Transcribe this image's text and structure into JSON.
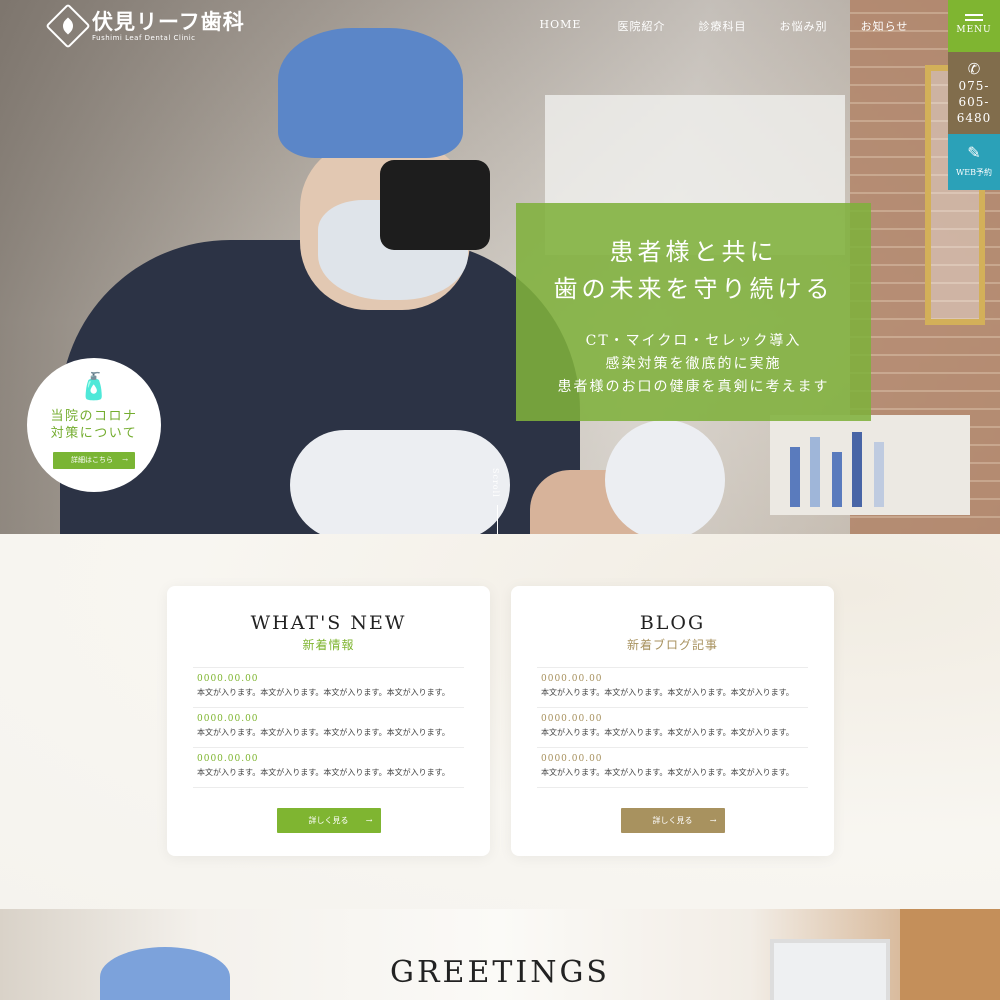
{
  "header": {
    "logo_name": "伏見リーフ歯科",
    "logo_sub": "Fushimi Leaf Dental Clinic",
    "nav": [
      "HOME",
      "医院紹介",
      "診療科目",
      "お悩み別",
      "お知らせ"
    ]
  },
  "side": {
    "menu_label": "MENU",
    "tel_lines": [
      "075-",
      "605-",
      "6480"
    ],
    "web_label": "WEB予約"
  },
  "hero": {
    "catch_line1": "患者様と共に",
    "catch_line2": "歯の未来を守り続ける",
    "points": [
      "CT・マイクロ・セレック導入",
      "感染対策を徹底的に実施",
      "患者様のお口の健康を真剣に考えます"
    ],
    "scroll_label": "Scroll"
  },
  "corona": {
    "line1": "当院のコロナ",
    "line2": "対策について",
    "button": "詳細はこちら"
  },
  "news": {
    "title": "WHAT'S NEW",
    "subtitle": "新着情報",
    "items": [
      {
        "date": "0000.00.00",
        "text": "本文が入ります。本文が入ります。本文が入ります。本文が入ります。"
      },
      {
        "date": "0000.00.00",
        "text": "本文が入ります。本文が入ります。本文が入ります。本文が入ります。"
      },
      {
        "date": "0000.00.00",
        "text": "本文が入ります。本文が入ります。本文が入ります。本文が入ります。"
      }
    ],
    "more": "詳しく見る",
    "accent": "#7fb531"
  },
  "blog": {
    "title": "BLOG",
    "subtitle": "新着ブログ記事",
    "items": [
      {
        "date": "0000.00.00",
        "text": "本文が入ります。本文が入ります。本文が入ります。本文が入ります。"
      },
      {
        "date": "0000.00.00",
        "text": "本文が入ります。本文が入ります。本文が入ります。本文が入ります。"
      },
      {
        "date": "0000.00.00",
        "text": "本文が入ります。本文が入ります。本文が入ります。本文が入ります。"
      }
    ],
    "more": "詳しく見る",
    "accent": "#a8925f"
  },
  "greetings": {
    "title": "GREETINGS"
  },
  "icons": {
    "logo": "leaf-logo-icon",
    "tel": "phone-icon",
    "web": "calendar-edit-icon",
    "corona": "sanitizer-icon"
  }
}
